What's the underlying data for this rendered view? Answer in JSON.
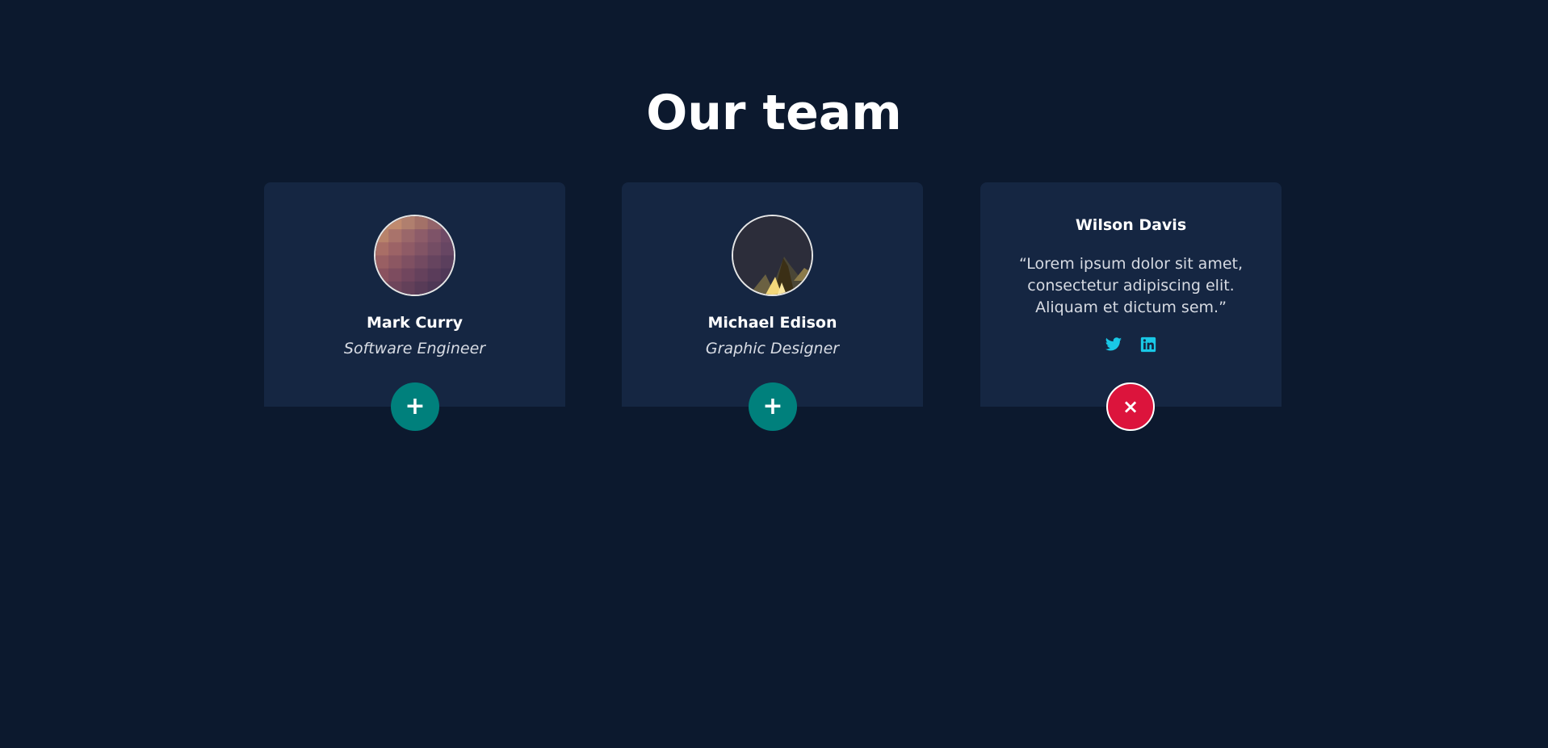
{
  "page": {
    "title": "Our team"
  },
  "colors": {
    "background": "#0c192e",
    "card": "#152642",
    "teal": "#00807c",
    "crimson": "#dc143c",
    "social_icon": "#19c8e6"
  },
  "members": [
    {
      "name": "Mark Curry",
      "role": "Software Engineer",
      "toggle": "+",
      "state": "collapsed"
    },
    {
      "name": "Michael Edison",
      "role": "Graphic Designer",
      "toggle": "+",
      "state": "collapsed"
    },
    {
      "name": "Wilson Davis",
      "quote": "“Lorem ipsum dolor sit amet, consectetur adipiscing elit. Aliquam et dictum sem.”",
      "socials": [
        "twitter-icon",
        "linkedin-icon"
      ],
      "toggle": "×",
      "state": "expanded"
    }
  ]
}
